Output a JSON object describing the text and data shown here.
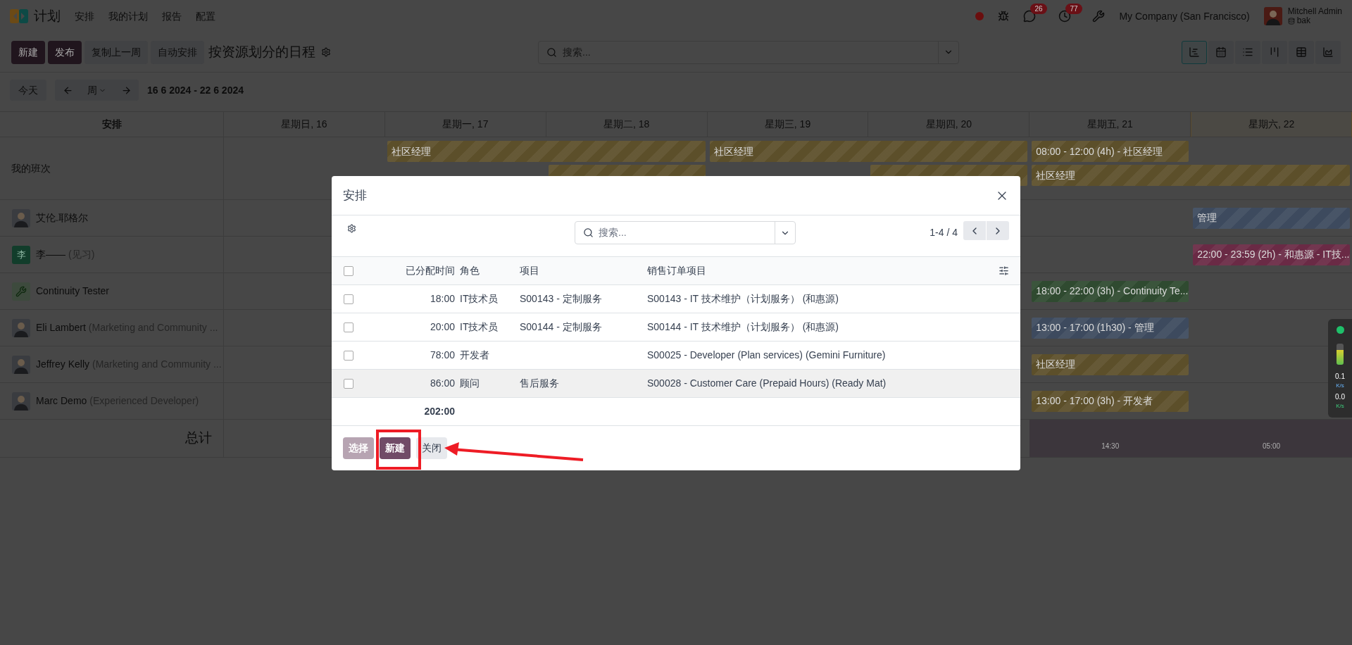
{
  "app_bar": {
    "app_name": "计划",
    "menu": [
      "安排",
      "我的计划",
      "报告",
      "配置"
    ],
    "messages_badge": "26",
    "activities_badge": "77",
    "company": "My Company (San Francisco)",
    "user": {
      "name": "Mitchell Admin",
      "database": "bak"
    }
  },
  "control_panel": {
    "buttons": [
      {
        "label": "新建",
        "kind": "primary"
      },
      {
        "label": "发布",
        "kind": "primary"
      },
      {
        "label": "复制上一周",
        "kind": "secondary"
      },
      {
        "label": "自动安排",
        "kind": "secondary"
      }
    ],
    "title": "按资源划分的日程",
    "search": {
      "placeholder": "搜索..."
    },
    "views": [
      {
        "selected": true
      },
      {
        "selected": false
      },
      {
        "selected": false
      },
      {
        "selected": false
      },
      {
        "selected": false
      },
      {
        "selected": false
      }
    ]
  },
  "date_nav": {
    "today": "今天",
    "scale": "周",
    "range": "16 6 2024 - 22 6 2024"
  },
  "gantt": {
    "header": "安排",
    "days": [
      {
        "label": "星期日, 16",
        "today": false
      },
      {
        "label": "星期一, 17",
        "today": false
      },
      {
        "label": "星期二, 18",
        "today": false
      },
      {
        "label": "星期三, 19",
        "today": false
      },
      {
        "label": "星期四, 20",
        "today": false
      },
      {
        "label": "星期五, 21",
        "today": false
      },
      {
        "label": "星期六, 22",
        "today": true
      }
    ],
    "my_shifts": {
      "label": "我的班次",
      "lanes": [
        [
          {
            "kind": "gap"
          },
          {
            "kind": "bar",
            "text": "社区经理",
            "color": "#5c4f2a"
          },
          {
            "kind": "more"
          },
          {
            "kind": "bar",
            "text": "社区经理",
            "color": "#5c4f2a"
          },
          {
            "kind": "more"
          },
          {
            "kind": "bar",
            "text": "08:00 - 12:00 (4h) - 社区经理",
            "color": "#5c4f2a"
          }
        ],
        [
          {
            "kind": "gap"
          },
          {
            "kind": "gap"
          },
          {
            "kind": "bar",
            "color": "#5c4f2a"
          },
          {
            "kind": "gap"
          },
          {
            "kind": "bar",
            "color": "#5c4f2a"
          },
          {
            "kind": "bar",
            "text": "社区经理",
            "color": "#5c4f2a"
          },
          {
            "kind": "more"
          }
        ]
      ]
    },
    "resources": [
      {
        "name": "艾伦.耶格尔",
        "kind": "photo",
        "segments": [
          {
            "kind": "gap"
          },
          {
            "kind": "gap"
          },
          {
            "kind": "gap"
          },
          {
            "kind": "gap"
          },
          {
            "kind": "gap"
          },
          {
            "kind": "gap"
          },
          {
            "kind": "bar",
            "text": "管理",
            "color": "#3d4a5e"
          }
        ]
      },
      {
        "name": "李——",
        "role": "(见习)",
        "kind": "letter",
        "initial": "李",
        "segments": [
          {
            "kind": "gap"
          },
          {
            "kind": "gap"
          },
          {
            "kind": "gap"
          },
          {
            "kind": "gap"
          },
          {
            "kind": "gap"
          },
          {
            "kind": "gap"
          },
          {
            "kind": "bar",
            "text": "22:00 - 23:59 (2h) - 和惠源 - IT技...",
            "color": "#6a2a45"
          }
        ]
      },
      {
        "name": "Continuity Tester",
        "kind": "wrench",
        "segments": [
          {
            "kind": "gap"
          },
          {
            "kind": "gap"
          },
          {
            "kind": "gap"
          },
          {
            "kind": "gap"
          },
          {
            "kind": "gap"
          },
          {
            "kind": "bar",
            "text": "18:00 - 22:00 (3h) - Continuity Te...",
            "color": "#2f4a30"
          }
        ]
      },
      {
        "name": "Eli Lambert",
        "role": "(Marketing and Community ...",
        "kind": "photo",
        "segments": [
          {
            "kind": "gap"
          },
          {
            "kind": "gap"
          },
          {
            "kind": "gap"
          },
          {
            "kind": "gap"
          },
          {
            "kind": "gap"
          },
          {
            "kind": "bar",
            "text": "13:00 - 17:00 (1h30) - 管理",
            "color": "#3d4a5e"
          }
        ]
      },
      {
        "name": "Jeffrey Kelly",
        "role": "(Marketing and Community ...",
        "kind": "photo",
        "segments": [
          {
            "kind": "gap"
          },
          {
            "kind": "gap"
          },
          {
            "kind": "gap"
          },
          {
            "kind": "gap"
          },
          {
            "kind": "gap"
          },
          {
            "kind": "bar",
            "text": "社区经理",
            "color": "#5c4f2a"
          }
        ]
      },
      {
        "name": "Marc Demo",
        "role": "(Experienced Developer)",
        "kind": "photo",
        "segments": [
          {
            "kind": "gap"
          },
          {
            "kind": "gap"
          },
          {
            "kind": "gap"
          },
          {
            "kind": "gap"
          },
          {
            "kind": "gap"
          },
          {
            "kind": "bar",
            "text": "13:00 - 17:00 (3h) - 开发者",
            "color": "#5c4f2a"
          }
        ]
      }
    ],
    "total_label": "总计",
    "totals": [
      {
        "kind": "gap"
      },
      {
        "kind": "gap"
      },
      {
        "kind": "gap"
      },
      {
        "kind": "gap"
      },
      {
        "kind": "gap"
      },
      {
        "kind": "total",
        "text": "14:30"
      },
      {
        "kind": "total",
        "text": "05:00"
      }
    ]
  },
  "dialog": {
    "title": "安排",
    "search": {
      "placeholder": "搜索..."
    },
    "pager": "1-4 / 4",
    "select_all": {
      "checked": false
    },
    "columns": [
      "已分配时间",
      "角色",
      "项目",
      "销售订单项目"
    ],
    "rows": [
      {
        "checked": false,
        "highlighted": false,
        "cells": [
          "18:00",
          "IT技术员",
          "S00143 - 定制服务",
          "S00143 - IT 技术维护（计划服务） (和惠源)"
        ]
      },
      {
        "checked": false,
        "highlighted": false,
        "cells": [
          "20:00",
          "IT技术员",
          "S00144 - 定制服务",
          "S00144 - IT 技术维护（计划服务） (和惠源)"
        ]
      },
      {
        "checked": false,
        "highlighted": false,
        "cells": [
          "78:00",
          "开发者",
          "",
          "S00025 - Developer (Plan services) (Gemini Furniture)"
        ]
      },
      {
        "checked": false,
        "highlighted": true,
        "cells": [
          "86:00",
          "顾问",
          "售后服务",
          "S00028 - Customer Care (Prepaid Hours) (Ready Mat)"
        ]
      }
    ],
    "total": "202:00",
    "buttons": [
      {
        "label": "选择",
        "kind": "primary",
        "disabled": true
      },
      {
        "label": "新建",
        "kind": "primary",
        "disabled": false
      },
      {
        "label": "关闭",
        "kind": "secondary",
        "disabled": false
      }
    ]
  },
  "net_monitor": {
    "upload": "0.1",
    "upload_unit": "K/s",
    "download": "0.0",
    "download_unit": "K/s"
  }
}
